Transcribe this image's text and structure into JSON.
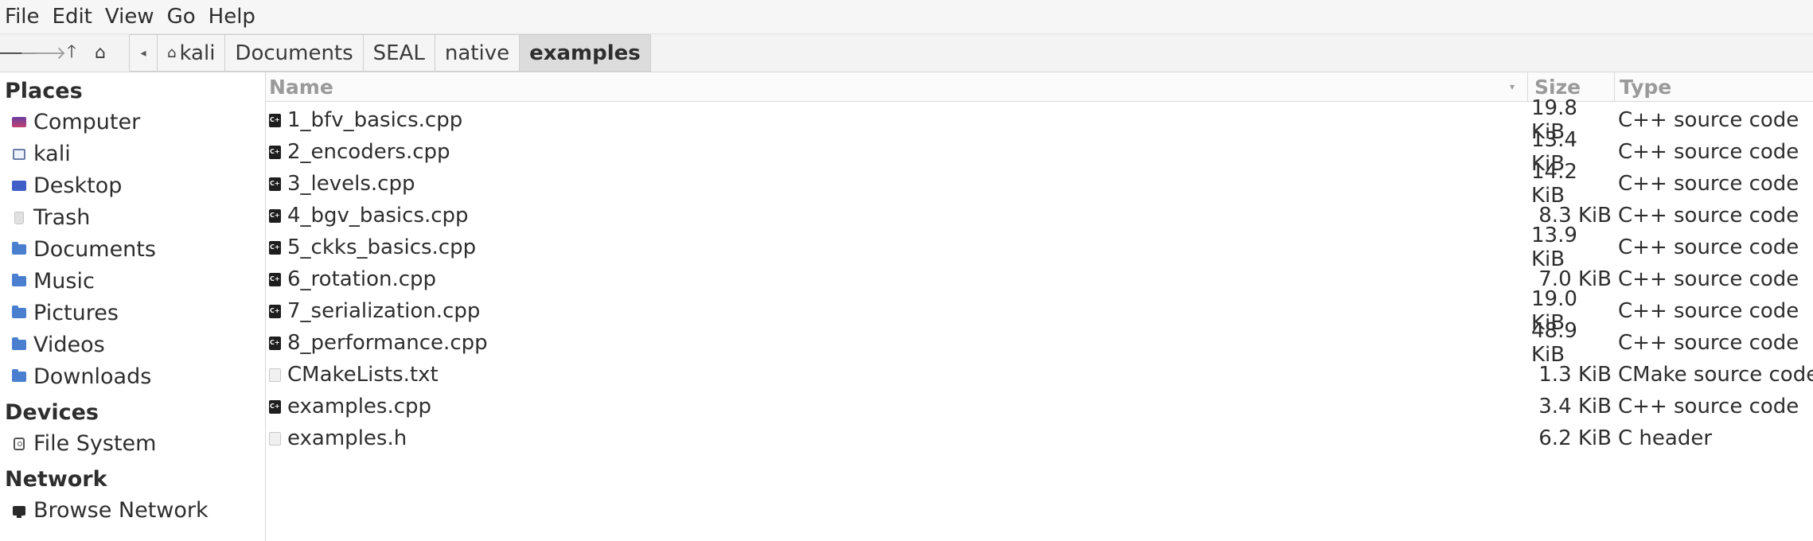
{
  "menubar": {
    "items": [
      "File",
      "Edit",
      "View",
      "Go",
      "Help"
    ]
  },
  "toolbar": {
    "nav_icons": [
      "back-arrow-icon",
      "forward-arrow-icon",
      "up-arrow-icon",
      "home-icon"
    ],
    "breadcrumbs": [
      "kali",
      "Documents",
      "SEAL",
      "native",
      "examples"
    ],
    "active_crumb": "examples"
  },
  "sidebar": {
    "places_title": "Places",
    "places": [
      {
        "label": "Computer",
        "icon": "computer-icon"
      },
      {
        "label": "kali",
        "icon": "home-folder-icon"
      },
      {
        "label": "Desktop",
        "icon": "desktop-icon"
      },
      {
        "label": "Trash",
        "icon": "trash-icon"
      },
      {
        "label": "Documents",
        "icon": "documents-folder-icon"
      },
      {
        "label": "Music",
        "icon": "music-folder-icon"
      },
      {
        "label": "Pictures",
        "icon": "pictures-folder-icon"
      },
      {
        "label": "Videos",
        "icon": "videos-folder-icon"
      },
      {
        "label": "Downloads",
        "icon": "downloads-folder-icon"
      }
    ],
    "devices_title": "Devices",
    "devices": [
      {
        "label": "File System",
        "icon": "disk-icon"
      }
    ],
    "network_title": "Network",
    "network": [
      {
        "label": "Browse Network",
        "icon": "network-icon"
      }
    ]
  },
  "list": {
    "columns": [
      "Name",
      "Size",
      "Type"
    ],
    "files": [
      {
        "name": "1_bfv_basics.cpp",
        "size": "19.8 KiB",
        "type": "C++ source code",
        "icon": "cpp-file-icon"
      },
      {
        "name": "2_encoders.cpp",
        "size": "13.4 KiB",
        "type": "C++ source code",
        "icon": "cpp-file-icon"
      },
      {
        "name": "3_levels.cpp",
        "size": "14.2 KiB",
        "type": "C++ source code",
        "icon": "cpp-file-icon"
      },
      {
        "name": "4_bgv_basics.cpp",
        "size": "8.3 KiB",
        "type": "C++ source code",
        "icon": "cpp-file-icon"
      },
      {
        "name": "5_ckks_basics.cpp",
        "size": "13.9 KiB",
        "type": "C++ source code",
        "icon": "cpp-file-icon"
      },
      {
        "name": "6_rotation.cpp",
        "size": "7.0 KiB",
        "type": "C++ source code",
        "icon": "cpp-file-icon"
      },
      {
        "name": "7_serialization.cpp",
        "size": "19.0 KiB",
        "type": "C++ source code",
        "icon": "cpp-file-icon"
      },
      {
        "name": "8_performance.cpp",
        "size": "48.9 KiB",
        "type": "C++ source code",
        "icon": "cpp-file-icon"
      },
      {
        "name": "CMakeLists.txt",
        "size": "1.3 KiB",
        "type": "CMake source code",
        "icon": "text-file-icon"
      },
      {
        "name": "examples.cpp",
        "size": "3.4 KiB",
        "type": "C++ source code",
        "icon": "cpp-file-icon"
      },
      {
        "name": "examples.h",
        "size": "6.2 KiB",
        "type": "C header",
        "icon": "header-file-icon"
      }
    ]
  }
}
